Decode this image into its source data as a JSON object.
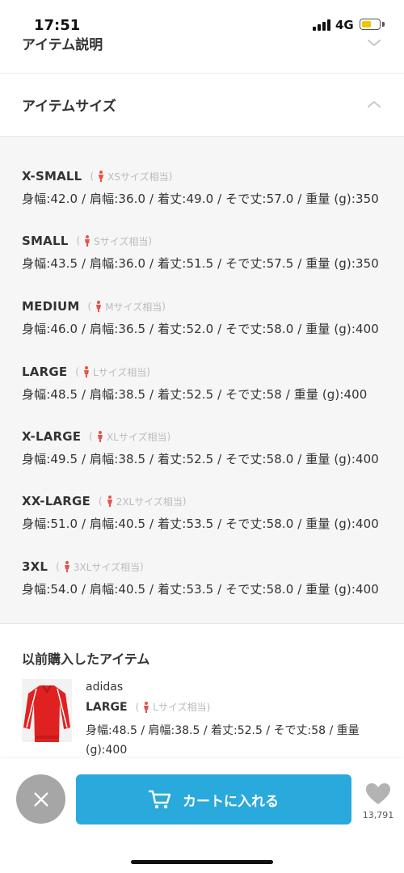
{
  "status_bar": {
    "time": "17:51",
    "network": "4G",
    "battery_color": "#f2c500"
  },
  "sections": {
    "description_title": "アイテム説明",
    "size_title": "アイテムサイズ"
  },
  "sizes": [
    {
      "name": "X-SMALL",
      "equiv": "XSサイズ相当",
      "measure": "身幅:42.0 / 肩幅:36.0 / 着丈:49.0 / そで丈:57.0 / 重量 (g):350"
    },
    {
      "name": "SMALL",
      "equiv": "Sサイズ相当",
      "measure": "身幅:43.5 / 肩幅:36.0 / 着丈:51.5 / そで丈:57.5 / 重量 (g):350"
    },
    {
      "name": "MEDIUM",
      "equiv": "Mサイズ相当",
      "measure": "身幅:46.0 / 肩幅:36.5 / 着丈:52.0 / そで丈:58.0 / 重量 (g):400"
    },
    {
      "name": "LARGE",
      "equiv": "Lサイズ相当",
      "measure": "身幅:48.5 / 肩幅:38.5 / 着丈:52.5 / そで丈:58 / 重量 (g):400"
    },
    {
      "name": "X-LARGE",
      "equiv": "XLサイズ相当",
      "measure": "身幅:49.5 / 肩幅:38.5 / 着丈:52.5 / そで丈:58.0 / 重量 (g):400"
    },
    {
      "name": "XX-LARGE",
      "equiv": "2XLサイズ相当",
      "measure": "身幅:51.0 / 肩幅:40.5 / 着丈:53.5 / そで丈:58.0 / 重量 (g):400"
    },
    {
      "name": "3XL",
      "equiv": "3XLサイズ相当",
      "measure": "身幅:54.0 / 肩幅:40.5 / 着丈:53.5 / そで丈:58.0 / 重量 (g):400"
    }
  ],
  "previous": {
    "title": "以前購入したアイテム",
    "brand": "adidas",
    "size": "LARGE",
    "equiv": "Lサイズ相当",
    "measure": "身幅:48.5 / 肩幅:38.5 / 着丈:52.5 / そで丈:58 / 重量 (g):400"
  },
  "bottom": {
    "cart_label": "カートに入れる",
    "fav_count": "13,791"
  },
  "icons": {
    "close": "close-icon",
    "cart": "cart-icon",
    "heart": "heart-icon",
    "person": "person-icon",
    "chevron_down": "chevron-down-icon",
    "chevron_up": "chevron-up-icon"
  },
  "colors": {
    "accent_blue": "#2aa9dd",
    "person_red": "#e8524a",
    "close_grey": "#a6a6a6"
  }
}
